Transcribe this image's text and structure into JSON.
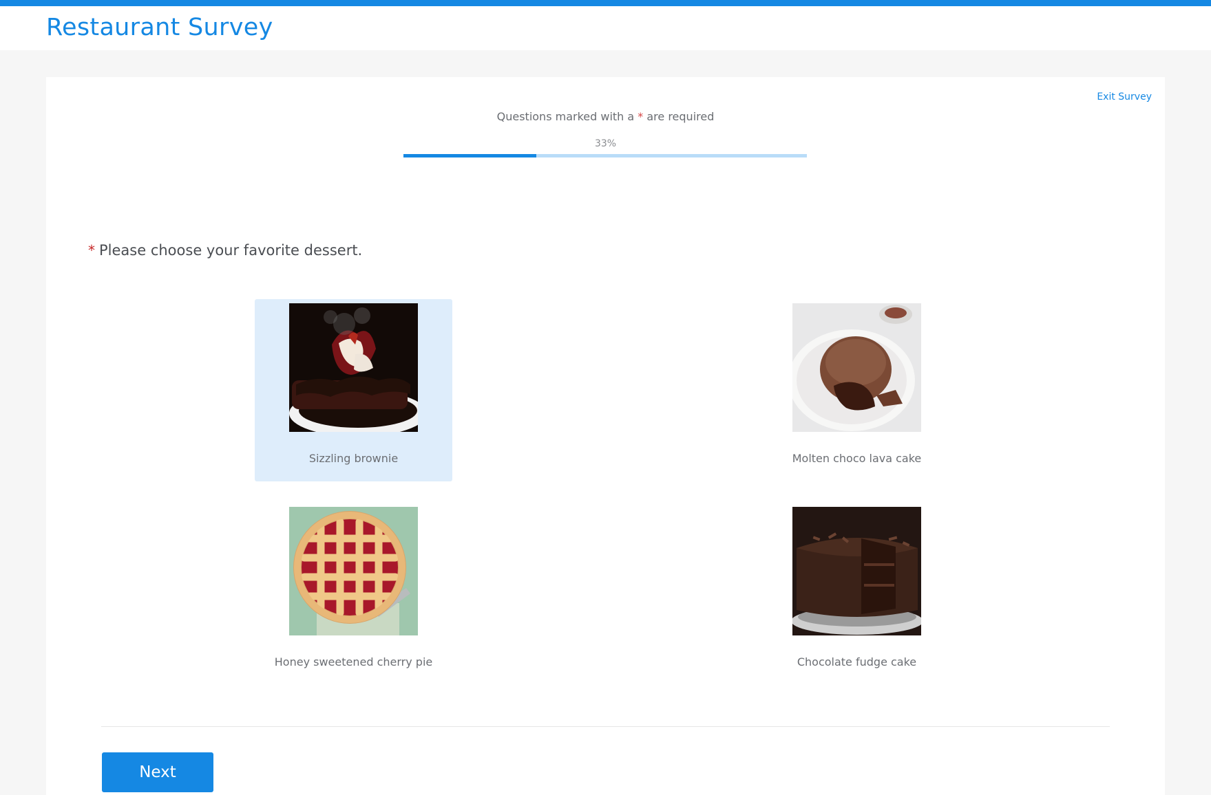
{
  "header": {
    "title": "Restaurant Survey"
  },
  "survey": {
    "exit_label": "Exit Survey",
    "required_prefix": "Questions marked with a ",
    "required_star": "*",
    "required_suffix": " are required",
    "progress_label": "33%",
    "progress": 0.33
  },
  "question": {
    "required_star": "*",
    "text": "Please choose your favorite dessert."
  },
  "options": [
    {
      "label": "Sizzling brownie",
      "selected": true,
      "icon": "brownie-image"
    },
    {
      "label": "Molten choco lava cake",
      "selected": false,
      "icon": "lava-cake-image"
    },
    {
      "label": "Honey sweetened cherry pie",
      "selected": false,
      "icon": "cherry-pie-image"
    },
    {
      "label": "Chocolate fudge cake",
      "selected": false,
      "icon": "fudge-cake-image"
    }
  ],
  "footer": {
    "next_label": "Next"
  },
  "colors": {
    "accent": "#1588e3",
    "progress_track": "#b9dcf8",
    "selected_bg": "#deedfb",
    "required": "#d64545"
  }
}
